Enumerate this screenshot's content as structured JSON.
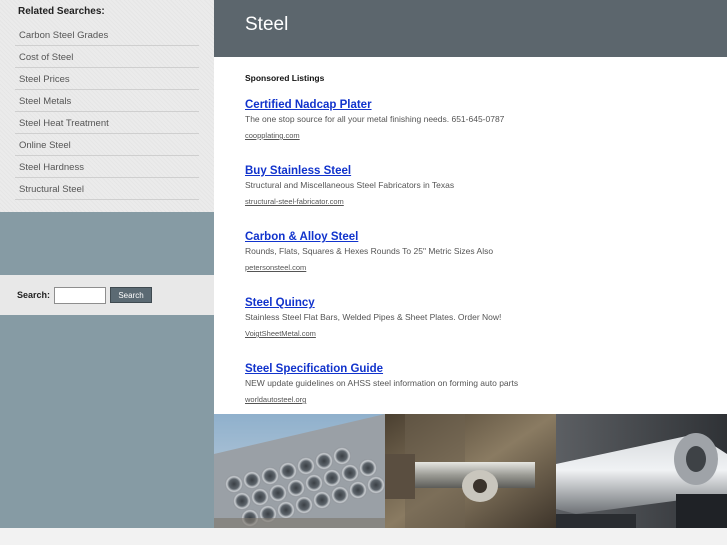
{
  "related": {
    "heading": "Related Searches:",
    "items": [
      "Carbon Steel Grades",
      "Cost of Steel",
      "Steel Prices",
      "Steel Metals",
      "Steel Heat Treatment",
      "Online Steel",
      "Steel Hardness",
      "Structural Steel"
    ]
  },
  "search": {
    "label": "Search:",
    "value": "",
    "button": "Search"
  },
  "header": {
    "title": "Steel"
  },
  "content": {
    "sponsored_label": "Sponsored Listings",
    "listings": [
      {
        "title": "Certified Nadcap Plater",
        "desc": "The one stop source for all your metal finishing needs. 651-645-0787",
        "url": "coopplating.com"
      },
      {
        "title": "Buy Stainless Steel",
        "desc": "Structural and Miscellaneous Steel Fabricators in Texas",
        "url": "structural-steel-fabricator.com"
      },
      {
        "title": "Carbon & Alloy Steel",
        "desc": "Rounds, Flats, Squares & Hexes Rounds To 25\" Metric Sizes Also",
        "url": "petersonsteel.com"
      },
      {
        "title": "Steel Quincy",
        "desc": "Stainless Steel Flat Bars, Welded Pipes & Sheet Plates. Order Now!",
        "url": "VoigtSheetMetal.com"
      },
      {
        "title": "Steel Specification Guide",
        "desc": "NEW update guidelines on AHSS steel information on forming auto parts",
        "url": "worldautosteel.org"
      }
    ]
  },
  "colors": {
    "header_bg": "#5c666d",
    "sidebar_bg": "#869ba4",
    "link": "#1133cc"
  }
}
